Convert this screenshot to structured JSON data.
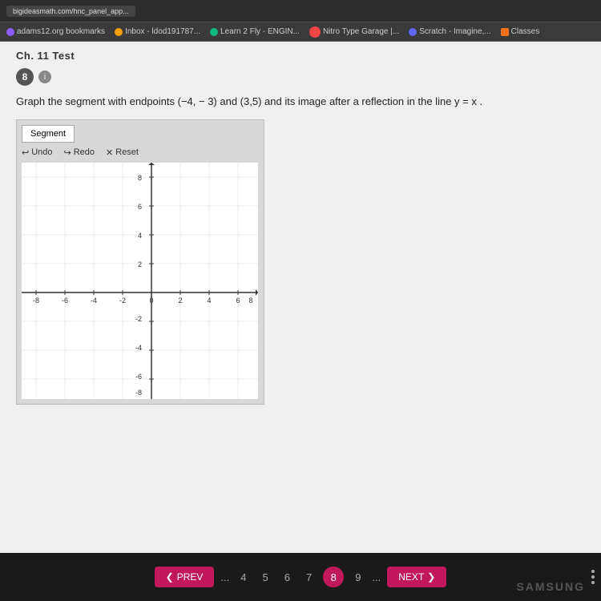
{
  "browser": {
    "tabs": [
      {
        "label": "bigideasmath.com/hnc_panel_app..."
      },
      {
        "label": "..."
      }
    ]
  },
  "bookmarks": {
    "items": [
      {
        "icon_color": "#8B5CF6",
        "label": "adams12.org bookmarks"
      },
      {
        "icon_color": "#f59e0b",
        "label": "Inbox - ldod191787..."
      },
      {
        "icon_color": "#10b981",
        "label": "Learn 2 Fly - ENGIN..."
      },
      {
        "icon_color": "#ef4444",
        "label": "Nitro Type Garage |..."
      },
      {
        "icon_color": "#6366f1",
        "label": "Scratch - Imagine,..."
      },
      {
        "icon_color": "#f97316",
        "label": "Classes"
      }
    ]
  },
  "page": {
    "header": "Ch. 11 Test",
    "question_number": "8",
    "question_text": "Graph the segment with endpoints (−4, − 3) and (3,5) and its image after a reflection in the line y = x .",
    "tool_label": "Segment",
    "toolbar": {
      "undo": "Undo",
      "redo": "Redo",
      "reset": "Reset"
    }
  },
  "grid": {
    "x_labels": [
      "-8",
      "-6",
      "-4",
      "-2",
      "0",
      "2",
      "4",
      "6",
      "8"
    ],
    "y_labels": [
      "8",
      "6",
      "4",
      "2",
      "-2",
      "-4",
      "-6",
      "-8"
    ]
  },
  "pagination": {
    "prev_label": "PREV",
    "next_label": "NEXT",
    "pages": [
      "4",
      "5",
      "6",
      "7",
      "8",
      "9"
    ],
    "current_page": "8",
    "dots": "..."
  },
  "branding": {
    "samsung_text": "SAMSUNG"
  }
}
